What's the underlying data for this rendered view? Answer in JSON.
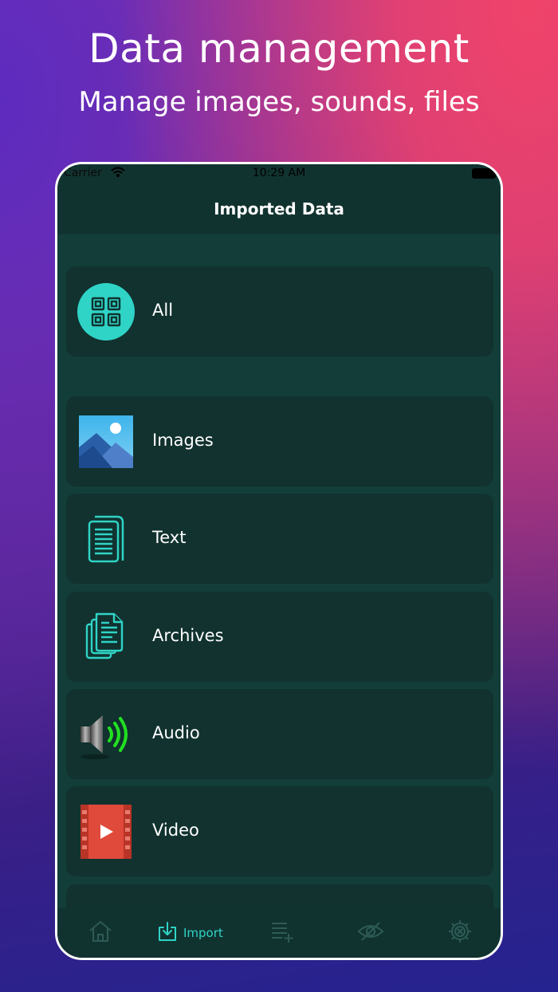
{
  "hero": {
    "title": "Data management",
    "subtitle": "Manage images, sounds, files"
  },
  "status_bar": {
    "carrier": "Carrier",
    "time": "10:29 AM"
  },
  "nav": {
    "title": "Imported Data"
  },
  "categories": [
    {
      "label": "All",
      "icon": "grid-icon"
    },
    {
      "label": "Images",
      "icon": "image-icon"
    },
    {
      "label": "Text",
      "icon": "text-document-icon"
    },
    {
      "label": "Archives",
      "icon": "archive-icon"
    },
    {
      "label": "Audio",
      "icon": "speaker-icon"
    },
    {
      "label": "Video",
      "icon": "video-icon"
    }
  ],
  "tab_bar": {
    "active": "import",
    "tabs": [
      {
        "id": "home",
        "icon": "home-icon",
        "label": ""
      },
      {
        "id": "import",
        "icon": "import-icon",
        "label": "Import"
      },
      {
        "id": "playlist",
        "icon": "add-list-icon",
        "label": ""
      },
      {
        "id": "hidden",
        "icon": "eye-off-icon",
        "label": ""
      },
      {
        "id": "settings",
        "icon": "gear-icon",
        "label": ""
      }
    ]
  },
  "colors": {
    "accent": "#2fd4c6",
    "panel": "#11322f",
    "background": "#133d39",
    "inactive_icon": "#2e5a55"
  }
}
